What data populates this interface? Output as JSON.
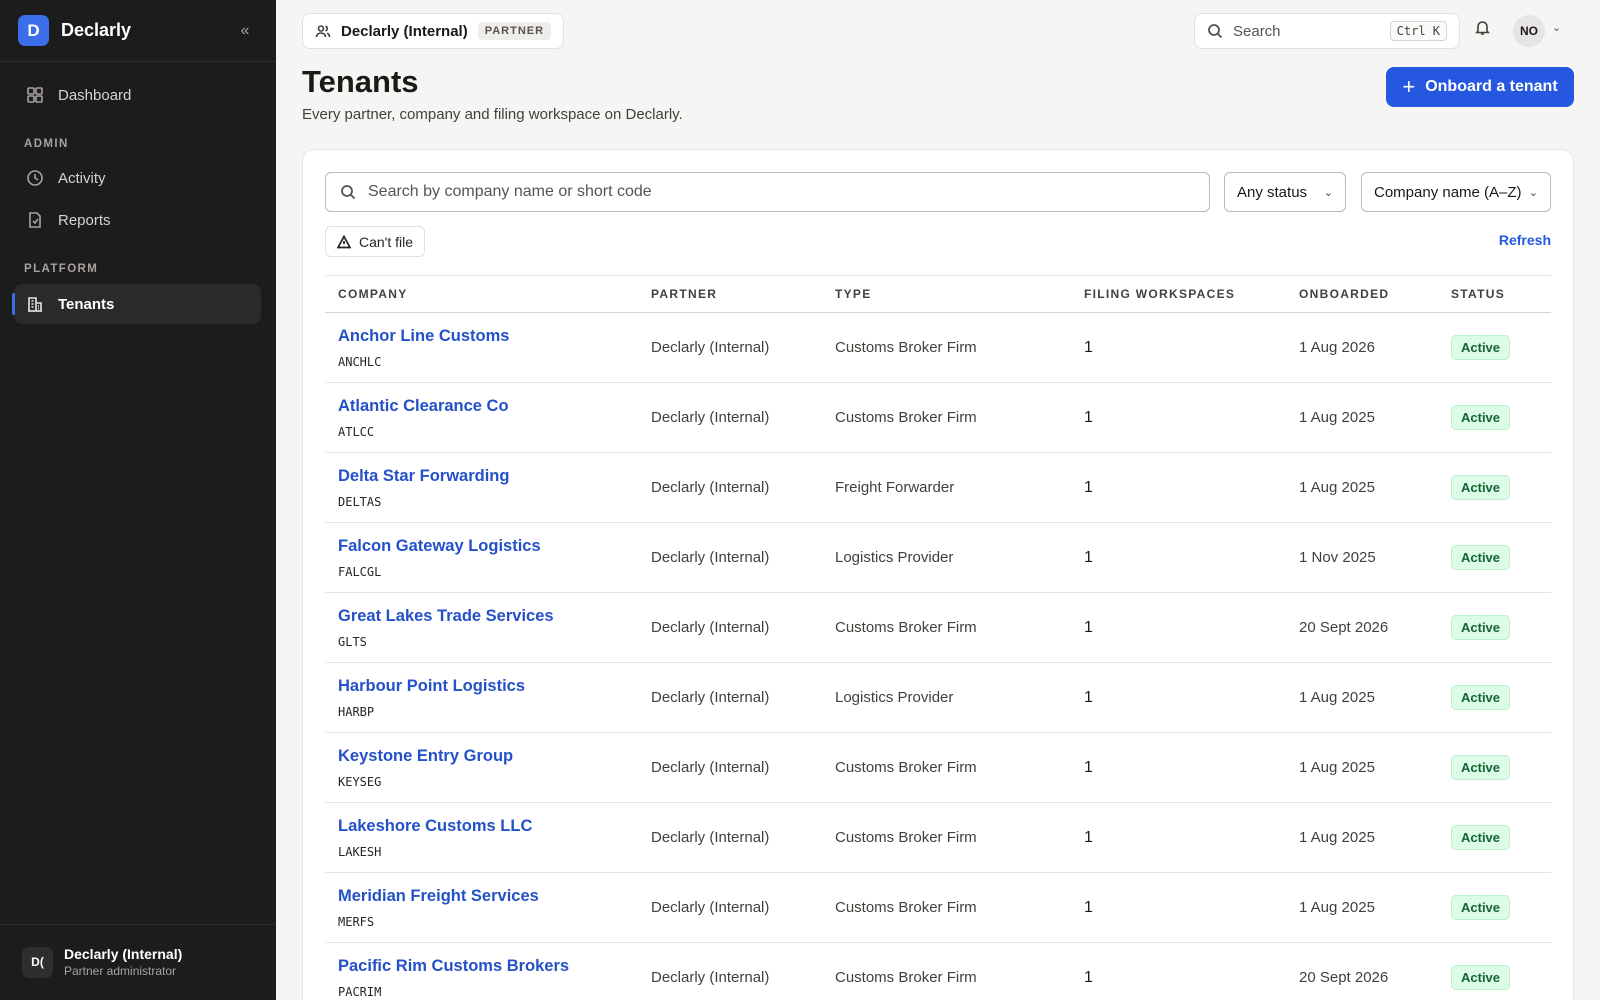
{
  "app": {
    "logo_letter": "D",
    "name": "Declarly"
  },
  "sidebar": {
    "dashboard": "Dashboard",
    "section_admin": "ADMIN",
    "activity": "Activity",
    "reports": "Reports",
    "section_platform": "PLATFORM",
    "tenants": "Tenants",
    "user": {
      "initials": "D(",
      "name": "Declarly (Internal)",
      "role": "Partner administrator"
    }
  },
  "topbar": {
    "org_name": "Declarly (Internal)",
    "org_badge": "PARTNER",
    "search_placeholder": "Search",
    "search_shortcut": "Ctrl K",
    "me_initials": "NO"
  },
  "page": {
    "title": "Tenants",
    "subtitle": "Every partner, company and filing workspace on Declarly.",
    "onboard_label": "Onboard a tenant"
  },
  "filters": {
    "search_placeholder": "Search by company name or short code",
    "status_value": "Any status",
    "sort_value": "Company name (A–Z)",
    "cant_file_label": "Can't file",
    "refresh_label": "Refresh"
  },
  "table": {
    "columns": [
      "COMPANY",
      "PARTNER",
      "TYPE",
      "FILING WORKSPACES",
      "ONBOARDED",
      "STATUS"
    ],
    "rows": [
      {
        "name": "Anchor Line Customs",
        "code": "ANCHLC",
        "partner": "Declarly (Internal)",
        "type": "Customs Broker Firm",
        "workspaces": "1",
        "onboarded": "1 Aug 2026",
        "status": "Active"
      },
      {
        "name": "Atlantic Clearance Co",
        "code": "ATLCC",
        "partner": "Declarly (Internal)",
        "type": "Customs Broker Firm",
        "workspaces": "1",
        "onboarded": "1 Aug 2025",
        "status": "Active"
      },
      {
        "name": "Delta Star Forwarding",
        "code": "DELTAS",
        "partner": "Declarly (Internal)",
        "type": "Freight Forwarder",
        "workspaces": "1",
        "onboarded": "1 Aug 2025",
        "status": "Active"
      },
      {
        "name": "Falcon Gateway Logistics",
        "code": "FALCGL",
        "partner": "Declarly (Internal)",
        "type": "Logistics Provider",
        "workspaces": "1",
        "onboarded": "1 Nov 2025",
        "status": "Active"
      },
      {
        "name": "Great Lakes Trade Services",
        "code": "GLTS",
        "partner": "Declarly (Internal)",
        "type": "Customs Broker Firm",
        "workspaces": "1",
        "onboarded": "20 Sept 2026",
        "status": "Active"
      },
      {
        "name": "Harbour Point Logistics",
        "code": "HARBP",
        "partner": "Declarly (Internal)",
        "type": "Logistics Provider",
        "workspaces": "1",
        "onboarded": "1 Aug 2025",
        "status": "Active"
      },
      {
        "name": "Keystone Entry Group",
        "code": "KEYSEG",
        "partner": "Declarly (Internal)",
        "type": "Customs Broker Firm",
        "workspaces": "1",
        "onboarded": "1 Aug 2025",
        "status": "Active"
      },
      {
        "name": "Lakeshore Customs LLC",
        "code": "LAKESH",
        "partner": "Declarly (Internal)",
        "type": "Customs Broker Firm",
        "workspaces": "1",
        "onboarded": "1 Aug 2025",
        "status": "Active"
      },
      {
        "name": "Meridian Freight Services",
        "code": "MERFS",
        "partner": "Declarly (Internal)",
        "type": "Customs Broker Firm",
        "workspaces": "1",
        "onboarded": "1 Aug 2025",
        "status": "Active"
      },
      {
        "name": "Pacific Rim Customs Brokers",
        "code": "PACRIM",
        "partner": "Declarly (Internal)",
        "type": "Customs Broker Firm",
        "workspaces": "1",
        "onboarded": "20 Sept 2026",
        "status": "Active"
      }
    ]
  },
  "colors": {
    "sidebar_bg": "#1c1c1c",
    "accent": "#2557e0",
    "link": "#2451c7",
    "status_active_bg": "#dcfce7",
    "status_active_text": "#166534"
  }
}
